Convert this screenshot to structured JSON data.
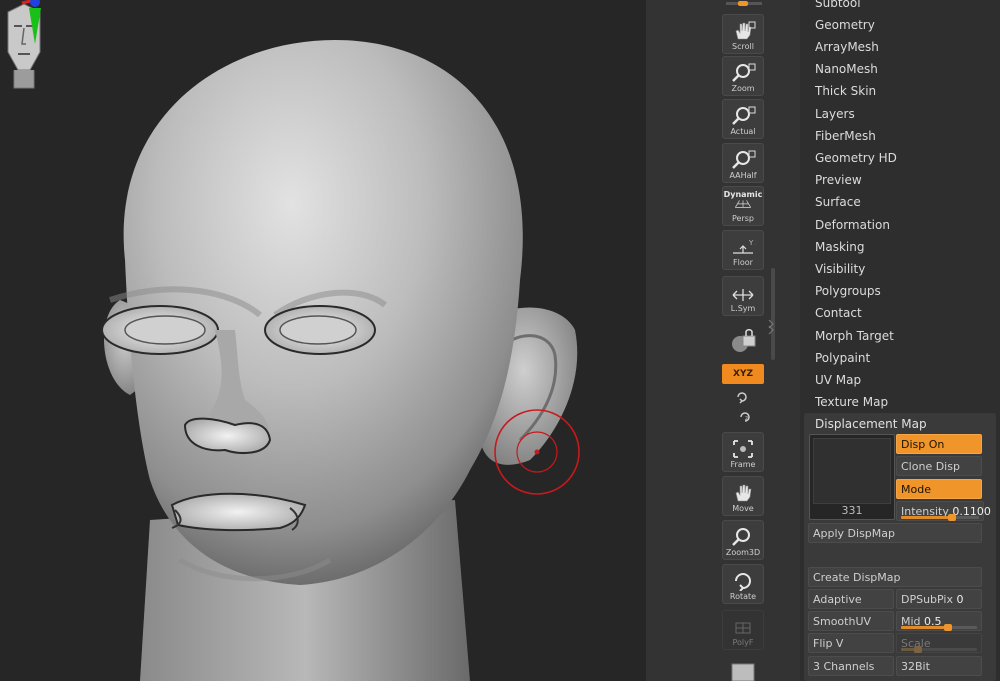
{
  "viewport": {
    "brush_active": true
  },
  "toolbar": {
    "buttons": [
      {
        "label": "Scroll",
        "icon": "hand-icon"
      },
      {
        "label": "Zoom",
        "icon": "zoom-icon"
      },
      {
        "label": "Actual",
        "icon": "actual-size-icon"
      },
      {
        "label": "AAHalf",
        "icon": "aa-half-icon"
      },
      {
        "label": "Persp",
        "icon": "perspective-icon",
        "top_label": "Dynamic"
      },
      {
        "label": "Floor",
        "icon": "floor-grid-icon"
      },
      {
        "label": "L.Sym",
        "icon": "local-symmetry-icon"
      },
      {
        "label": "Frame",
        "icon": "frame-icon"
      },
      {
        "label": "Move",
        "icon": "move-icon"
      },
      {
        "label": "Zoom3D",
        "icon": "zoom3d-icon"
      },
      {
        "label": "Rotate",
        "icon": "rotate-icon"
      },
      {
        "label": "PolyF",
        "icon": "polyframe-icon"
      }
    ],
    "xyz_label": "XYZ"
  },
  "palette": {
    "menu": [
      "Subtool",
      "Geometry",
      "ArrayMesh",
      "NanoMesh",
      "Thick Skin",
      "Layers",
      "FiberMesh",
      "Geometry HD",
      "Preview",
      "Surface",
      "Deformation",
      "Masking",
      "Visibility",
      "Polygroups",
      "Contact",
      "Morph Target",
      "Polypaint",
      "UV Map",
      "Texture Map"
    ],
    "displacement": {
      "title": "Displacement Map",
      "thumb_number": "331",
      "disp_on": "Disp On",
      "clone_disp": "Clone Disp",
      "mode": "Mode",
      "intensity_label": "Intensity",
      "intensity_value": "0.1100",
      "intensity_level": 0.65,
      "apply": "Apply DispMap",
      "create": "Create DispMap",
      "adaptive": "Adaptive",
      "dpsubpix_label": "DPSubPix",
      "dpsubpix_value": "0",
      "smoothuv": "SmoothUV",
      "mid_label": "Mid",
      "mid_value": "0.5",
      "mid_level": 0.62,
      "flipv": "Flip V",
      "scale_label": "Scale",
      "scale_level": 0.22,
      "channels": "3 Channels",
      "bits": "32Bit"
    }
  },
  "colors": {
    "accent": "#f0952a",
    "panel": "#2e2e2e",
    "toolbar": "#333333"
  }
}
